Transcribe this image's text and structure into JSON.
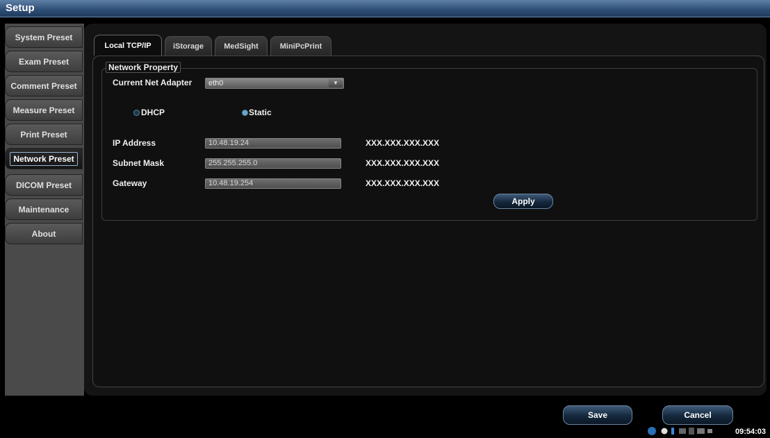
{
  "window": {
    "title": "Setup"
  },
  "sidebar": {
    "items": [
      {
        "label": "System Preset",
        "active": false
      },
      {
        "label": "Exam Preset",
        "active": false
      },
      {
        "label": "Comment Preset",
        "active": false
      },
      {
        "label": "Measure Preset",
        "active": false
      },
      {
        "label": "Print Preset",
        "active": false
      },
      {
        "label": "Network Preset",
        "active": true
      },
      {
        "label": "DICOM Preset",
        "active": false
      },
      {
        "label": "Maintenance",
        "active": false
      },
      {
        "label": "About",
        "active": false
      }
    ]
  },
  "tabs": [
    {
      "label": "Local TCP/IP",
      "active": true
    },
    {
      "label": "iStorage",
      "active": false
    },
    {
      "label": "MedSight",
      "active": false
    },
    {
      "label": "MiniPcPrint",
      "active": false
    }
  ],
  "network": {
    "group_title": "Network Property",
    "adapter_label": "Current Net Adapter",
    "adapter_value": "eth0",
    "dhcp_label": "DHCP",
    "static_label": "Static",
    "selected_mode": "Static",
    "ip_label": "IP Address",
    "ip_value": "10.48.19.24",
    "mask_label": "Subnet Mask",
    "mask_value": "255.255.255.0",
    "gateway_label": "Gateway",
    "gateway_value": "10.48.19.254",
    "format_hint": "XXX.XXX.XXX.XXX",
    "apply_label": "Apply"
  },
  "footer": {
    "save_label": "Save",
    "cancel_label": "Cancel",
    "clock": "09:54:03"
  },
  "colors": {
    "titlebar": "#2e4d74",
    "button_accent": "#15283d",
    "radio_accent": "#6aa7c9"
  }
}
